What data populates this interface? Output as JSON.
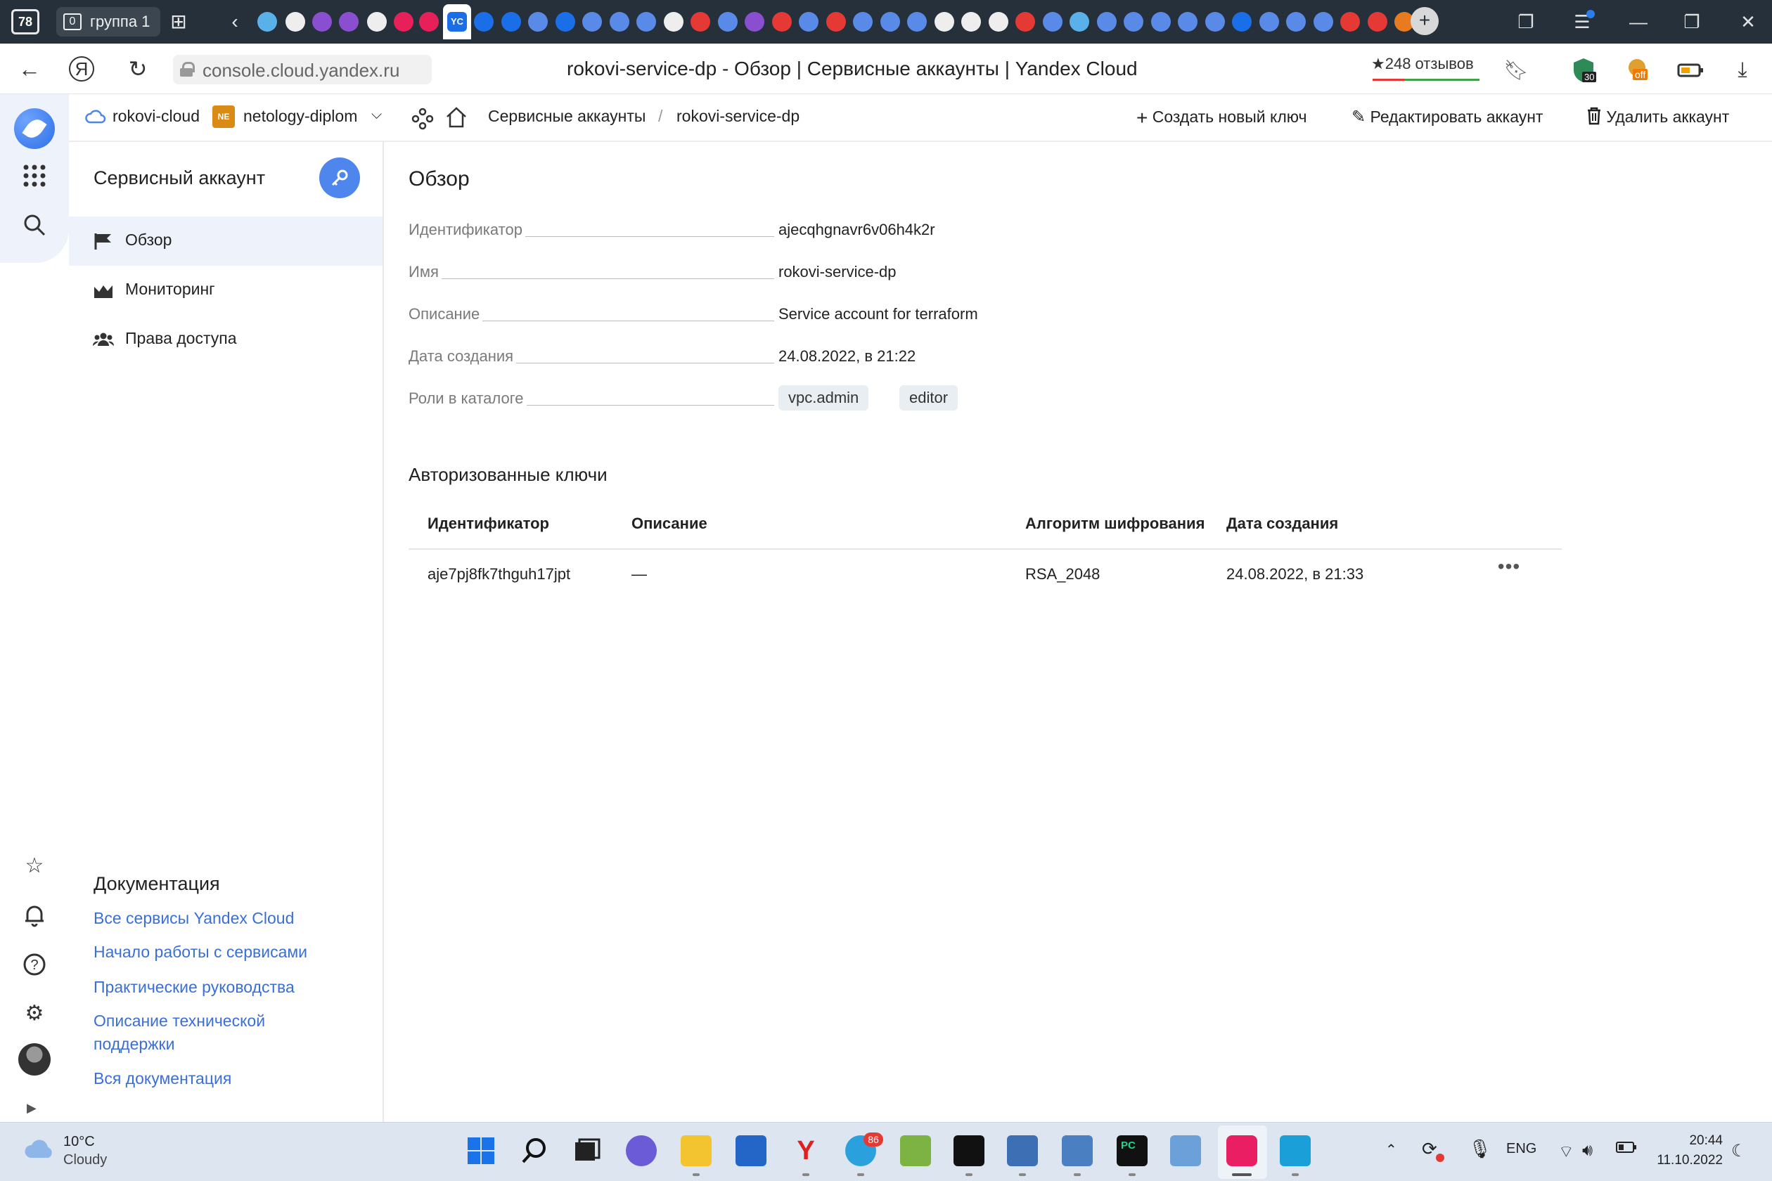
{
  "browser": {
    "tab_count": "78",
    "group_count": "0",
    "group_label": "группа 1",
    "active_tab_glyph": "YC",
    "url": "console.cloud.yandex.ru",
    "page_title": "rokovi-service-dp - Обзор | Сервисные аккаунты | Yandex Cloud",
    "reviews": "★248 отзывов",
    "ext_badge_30": "30",
    "ext_badge_off": "off"
  },
  "header": {
    "cloud": "rokovi-cloud",
    "folder_badge": "NE",
    "folder": "netology-diplom",
    "breadcrumb_parent": "Сервисные аккаунты",
    "breadcrumb_sep": "/",
    "breadcrumb_current": "rokovi-service-dp",
    "actions": {
      "create_key": "Создать новый ключ",
      "edit": "Редактировать аккаунт",
      "delete": "Удалить аккаунт"
    }
  },
  "sidenav": {
    "title": "Сервисный аккаунт",
    "items": [
      {
        "label": "Обзор",
        "active": true
      },
      {
        "label": "Мониторинг",
        "active": false
      },
      {
        "label": "Права доступа",
        "active": false
      }
    ],
    "docs_title": "Документация",
    "docs_links": [
      "Все сервисы Yandex Cloud",
      "Начало работы с сервисами",
      "Практические руководства",
      "Описание технической поддержки",
      "Вся документация"
    ]
  },
  "overview": {
    "title": "Обзор",
    "props": [
      {
        "label": "Идентификатор",
        "value": "ajecqhgnavr6v06h4k2r"
      },
      {
        "label": "Имя",
        "value": "rokovi-service-dp"
      },
      {
        "label": "Описание",
        "value": "Service account for terraform"
      },
      {
        "label": "Дата создания",
        "value": "24.08.2022, в 21:22"
      }
    ],
    "roles_label": "Роли в каталоге",
    "roles": [
      "vpc.admin",
      "editor"
    ]
  },
  "keys": {
    "title": "Авторизованные ключи",
    "columns": [
      "Идентификатор",
      "Описание",
      "Алгоритм шифрования",
      "Дата создания"
    ],
    "rows": [
      {
        "id": "aje7pj8fk7thguh17jpt",
        "description": "—",
        "algorithm": "RSA_2048",
        "created": "24.08.2022, в 21:33"
      }
    ],
    "row_menu": "•••"
  },
  "taskbar": {
    "temperature": "10°C",
    "weather": "Cloudy",
    "telegram_badge": "86",
    "lang": "ENG",
    "time": "20:44",
    "date": "11.10.2022"
  },
  "colors": {
    "accent": "#4f86ee",
    "link": "#3a6fd8",
    "active_nav_bg": "#eef2fa",
    "tabstrip_bg": "#26303a",
    "folder_badge": "#d98b15"
  }
}
